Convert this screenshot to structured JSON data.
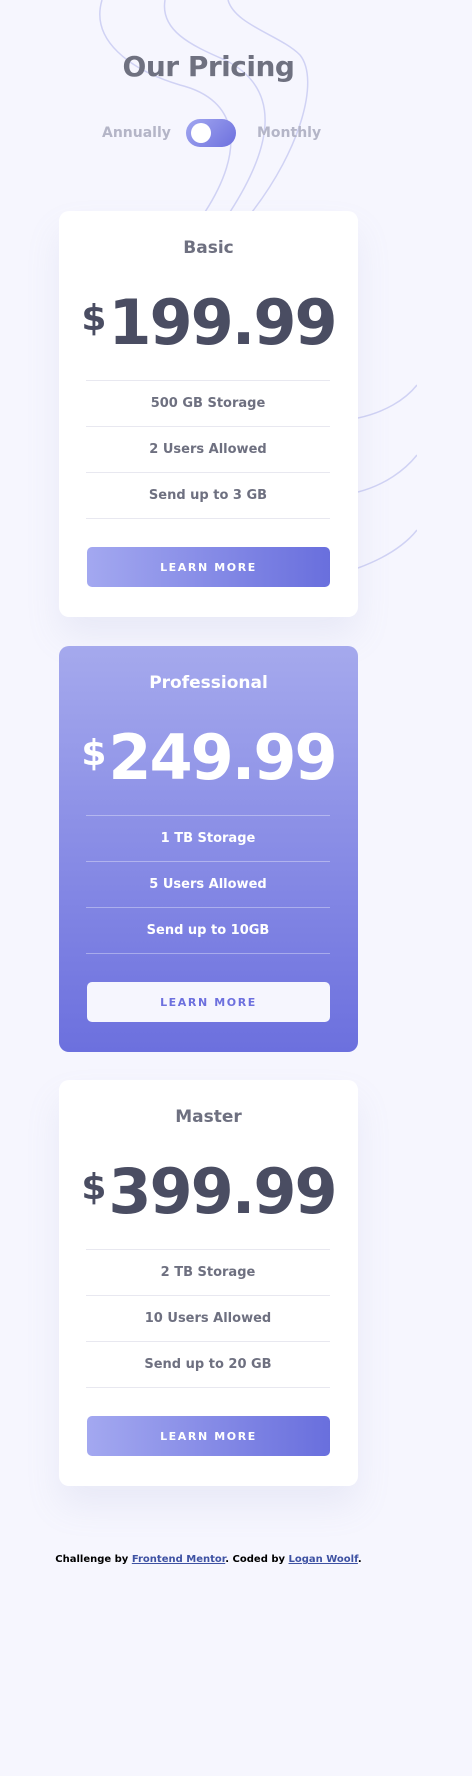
{
  "header": {
    "title": "Our Pricing"
  },
  "toggle": {
    "left_label": "Annually",
    "right_label": "Monthly",
    "state": "annually"
  },
  "plans": [
    {
      "name": "Basic",
      "currency": "$",
      "price": "199.99",
      "features": [
        "500 GB Storage",
        "2 Users Allowed",
        "Send up to 3 GB"
      ],
      "button_label": "LEARN MORE"
    },
    {
      "name": "Professional",
      "currency": "$",
      "price": "249.99",
      "features": [
        "1 TB Storage",
        "5 Users Allowed",
        "Send up to 10GB"
      ],
      "button_label": "LEARN MORE"
    },
    {
      "name": "Master",
      "currency": "$",
      "price": "399.99",
      "features": [
        "2 TB Storage",
        "10 Users Allowed",
        "Send up to 20 GB"
      ],
      "button_label": "LEARN MORE"
    }
  ],
  "footer": {
    "prefix": "Challenge by ",
    "link1": "Frontend Mentor",
    "middle": ". Coded by ",
    "link2": "Logan Woolf",
    "suffix": "."
  },
  "colors": {
    "background": "#f6f6fe",
    "accent_light": "#a3a8f0",
    "accent_dark": "#696fdd",
    "text_dark": "#4a4d62",
    "text_muted": "#6e7080"
  }
}
